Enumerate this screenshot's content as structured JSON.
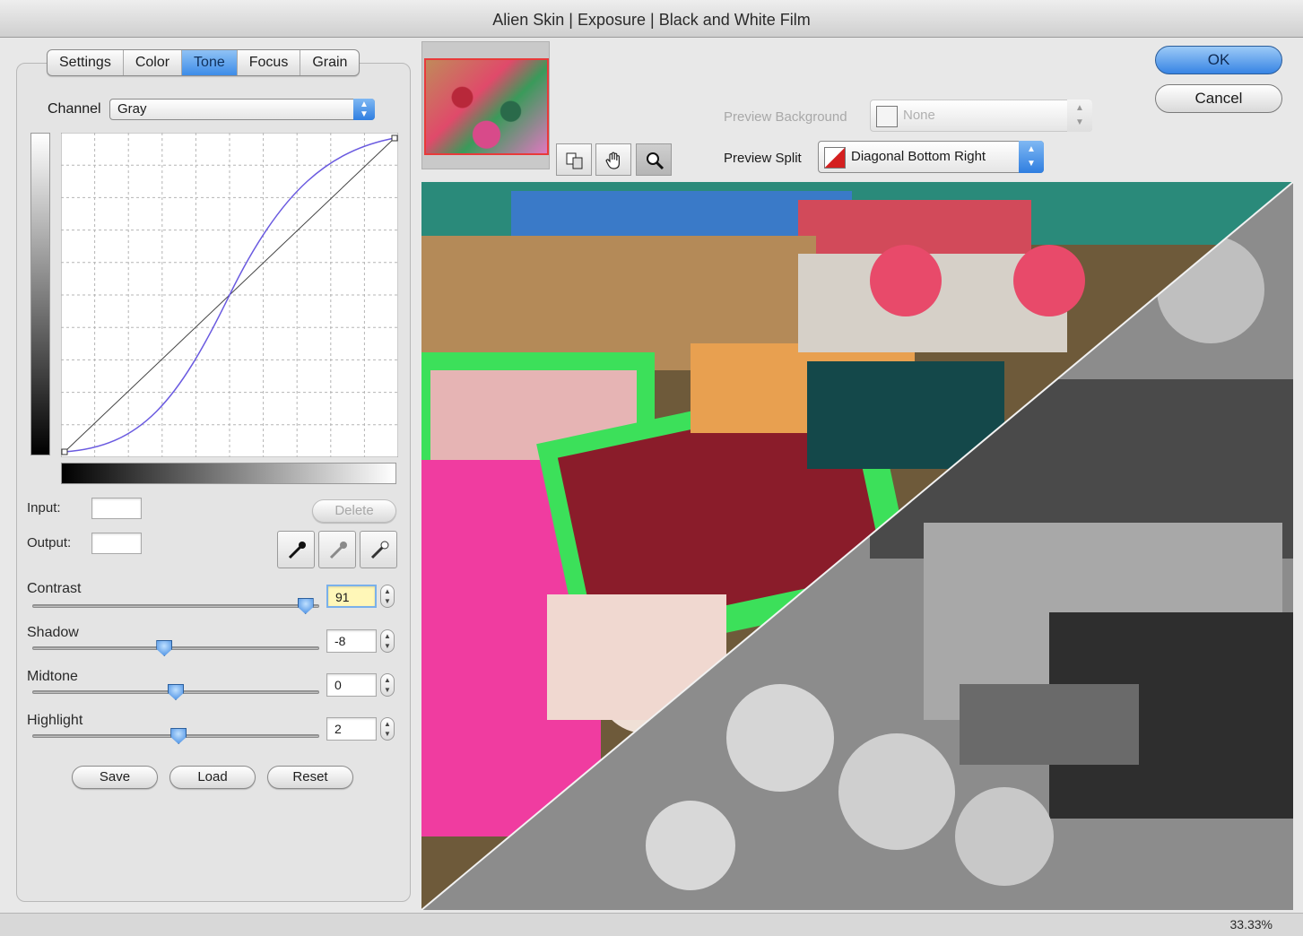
{
  "window": {
    "title": "Alien Skin | Exposure | Black and White Film"
  },
  "tabs": [
    {
      "label": "Settings",
      "active": false
    },
    {
      "label": "Color",
      "active": false
    },
    {
      "label": "Tone",
      "active": true
    },
    {
      "label": "Focus",
      "active": false
    },
    {
      "label": "Grain",
      "active": false
    }
  ],
  "channel": {
    "label": "Channel",
    "value": "Gray"
  },
  "curve_fields": {
    "input_label": "Input:",
    "output_label": "Output:",
    "input_value": "",
    "output_value": "",
    "delete_label": "Delete"
  },
  "eyedroppers": [
    {
      "icon": "black-point-eyedropper-icon"
    },
    {
      "icon": "gray-point-eyedropper-icon"
    },
    {
      "icon": "white-point-eyedropper-icon"
    }
  ],
  "sliders": [
    {
      "label": "Contrast",
      "value": "91",
      "min": -100,
      "max": 100
    },
    {
      "label": "Shadow",
      "value": "-8",
      "min": -100,
      "max": 100
    },
    {
      "label": "Midtone",
      "value": "0",
      "min": -100,
      "max": 100
    },
    {
      "label": "Highlight",
      "value": "2",
      "min": -100,
      "max": 100
    }
  ],
  "buttons": {
    "save": "Save",
    "load": "Load",
    "reset": "Reset",
    "ok": "OK",
    "cancel": "Cancel"
  },
  "preview_options": {
    "background_label": "Preview Background",
    "background_value": "None",
    "split_label": "Preview Split",
    "split_value": "Diagonal Bottom Right"
  },
  "tools": [
    {
      "icon": "compare-icon",
      "active": false
    },
    {
      "icon": "hand-icon",
      "active": false
    },
    {
      "icon": "zoom-icon",
      "active": true
    }
  ],
  "status": {
    "zoom": "33.33%"
  },
  "colors": {
    "accent": "#3d8ce8",
    "curve": "#6a5ae0"
  }
}
